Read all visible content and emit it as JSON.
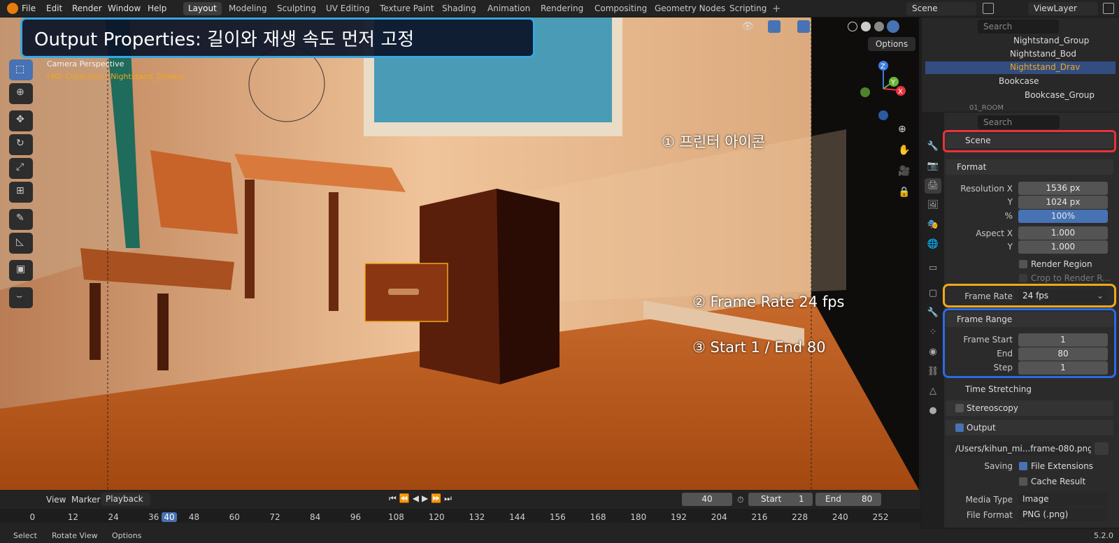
{
  "menu": {
    "file": "File",
    "edit": "Edit",
    "render": "Render",
    "window": "Window",
    "help": "Help"
  },
  "workspaces": [
    "Layout",
    "Modeling",
    "Sculpting",
    "UV Editing",
    "Texture Paint",
    "Shading",
    "Animation",
    "Rendering",
    "Compositing",
    "Geometry Nodes",
    "Scripting"
  ],
  "active_workspace": "Layout",
  "scene_name": "Scene",
  "view_layer": "ViewLayer",
  "banner": "Output Properties: 길이와 재생 속도 먼저 고정",
  "viewport": {
    "camera_label": "Camera Perspective",
    "collection_label": "(40) Collection | Nightstand_Drawer",
    "options": "Options"
  },
  "callouts": {
    "c1": "① 프린터 아이콘",
    "c2": "② Frame Rate 24 fps",
    "c3": "③ Start 1 / End 80"
  },
  "outliner": {
    "search_placeholder": "Search",
    "items": [
      "Nightstand_Group",
      "Nightstand_Bod",
      "Nightstand_Drav",
      "Bookcase",
      "Bookcase_Group",
      "01_ROOM"
    ]
  },
  "properties": {
    "search_placeholder": "Search",
    "context": "Scene",
    "format": {
      "header": "Format",
      "res_x_label": "Resolution X",
      "res_x": "1536 px",
      "res_y_label": "Y",
      "res_y": "1024 px",
      "pct_label": "%",
      "pct": "100%",
      "pct_value": 1.0,
      "aspect_x_label": "Aspect X",
      "aspect_x": "1.000",
      "aspect_y_label": "Y",
      "aspect_y": "1.000",
      "render_region": "Render Region",
      "crop": "Crop to Render R...",
      "frame_rate_label": "Frame Rate",
      "frame_rate": "24 fps"
    },
    "frame_range": {
      "header": "Frame Range",
      "start_label": "Frame Start",
      "start": "1",
      "end_label": "End",
      "end": "80",
      "step_label": "Step",
      "step": "1"
    },
    "time_stretching": "Time Stretching",
    "stereoscopy": "Stereoscopy",
    "output": {
      "header": "Output",
      "path": "/Users/kihun_mi...frame-080.png",
      "saving_label": "Saving",
      "file_ext": "File Extensions",
      "cache": "Cache Result",
      "media_type_label": "Media Type",
      "media_type": "Image",
      "file_format_label": "File Format",
      "file_format": "PNG (.png)"
    }
  },
  "timeline": {
    "view": "View",
    "marker": "Marker",
    "playback": "Playback",
    "current_frame": "40",
    "start_label": "Start",
    "start": "1",
    "end_label": "End",
    "end": "80",
    "ticks": [
      "0",
      "12",
      "24",
      "36",
      "40",
      "48",
      "60",
      "72",
      "84",
      "96",
      "108",
      "120",
      "132",
      "144",
      "156",
      "168",
      "180",
      "192",
      "204",
      "216",
      "228",
      "240",
      "252"
    ]
  },
  "statusbar": {
    "select": "Select",
    "rotate": "Rotate View",
    "options": "Options",
    "version": "5.2.0"
  },
  "colors": {
    "accent": "#4772b3",
    "highlight_red": "#e8323c",
    "highlight_yellow": "#f0a81c",
    "highlight_blue": "#2b6be6",
    "banner_border": "#3aa6e0"
  }
}
